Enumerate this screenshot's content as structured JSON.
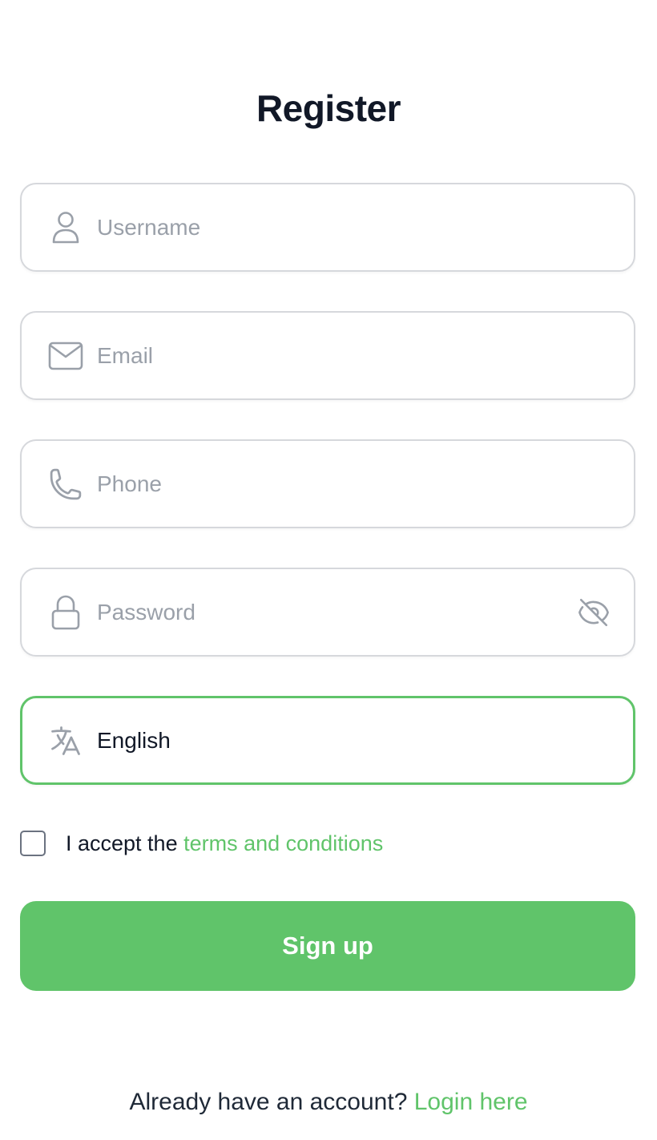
{
  "form": {
    "title": "Register",
    "username": {
      "placeholder": "Username",
      "value": "",
      "icon": "user-icon"
    },
    "email": {
      "placeholder": "Email",
      "value": "",
      "icon": "mail-icon"
    },
    "phone": {
      "placeholder": "Phone",
      "value": "",
      "icon": "phone-icon"
    },
    "password": {
      "placeholder": "Password",
      "value": "",
      "icon": "lock-icon",
      "toggle_icon": "eye-off-icon"
    },
    "language": {
      "value": "English",
      "icon": "translate-icon"
    },
    "terms": {
      "prefix": "I accept the ",
      "link": "terms and conditions",
      "checked": false
    },
    "submit_label": "Sign up"
  },
  "footer": {
    "prompt": "Already have an account? ",
    "link": "Login here"
  },
  "colors": {
    "accent": "#60c46a",
    "text": "#111827",
    "placeholder": "#9aa0a9",
    "border": "#d6d8dc",
    "icon": "#9aa0a9"
  }
}
